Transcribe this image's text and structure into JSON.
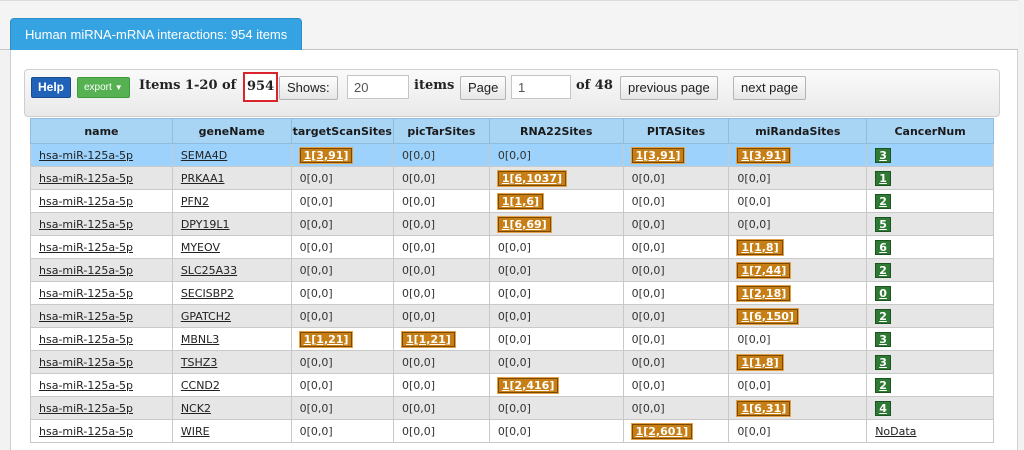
{
  "tab": {
    "title": "Human miRNA-mRNA interactions: 954 items"
  },
  "toolbar": {
    "help_label": "Help",
    "export_label": "export",
    "items_prefix": "Items 1-20 of",
    "total": "954",
    "shows_label": "Shows:",
    "shows_value": "20",
    "items_label": "items",
    "page_label": "Page",
    "page_value": "1",
    "of_pages": "of 48",
    "prev_label": "previous page",
    "next_label": "next page"
  },
  "table": {
    "columns": [
      "name",
      "geneName",
      "targetScanSites",
      "picTarSites",
      "RNA22Sites",
      "PITASites",
      "miRandaSites",
      "CancerNum"
    ],
    "rows": [
      {
        "name": "hsa-miR-125a-5p",
        "gene": "SEMA4D",
        "ts": "1[3,91]",
        "pt": "0[0,0]",
        "r22": "0[0,0]",
        "pita": "1[3,91]",
        "mir": "1[3,91]",
        "cancer": "3"
      },
      {
        "name": "hsa-miR-125a-5p",
        "gene": "PRKAA1",
        "ts": "0[0,0]",
        "pt": "0[0,0]",
        "r22": "1[6,1037]",
        "pita": "0[0,0]",
        "mir": "0[0,0]",
        "cancer": "1"
      },
      {
        "name": "hsa-miR-125a-5p",
        "gene": "PFN2",
        "ts": "0[0,0]",
        "pt": "0[0,0]",
        "r22": "1[1,6]",
        "pita": "0[0,0]",
        "mir": "0[0,0]",
        "cancer": "2"
      },
      {
        "name": "hsa-miR-125a-5p",
        "gene": "DPY19L1",
        "ts": "0[0,0]",
        "pt": "0[0,0]",
        "r22": "1[6,69]",
        "pita": "0[0,0]",
        "mir": "0[0,0]",
        "cancer": "5"
      },
      {
        "name": "hsa-miR-125a-5p",
        "gene": "MYEOV",
        "ts": "0[0,0]",
        "pt": "0[0,0]",
        "r22": "0[0,0]",
        "pita": "0[0,0]",
        "mir": "1[1,8]",
        "cancer": "6"
      },
      {
        "name": "hsa-miR-125a-5p",
        "gene": "SLC25A33",
        "ts": "0[0,0]",
        "pt": "0[0,0]",
        "r22": "0[0,0]",
        "pita": "0[0,0]",
        "mir": "1[7,44]",
        "cancer": "2"
      },
      {
        "name": "hsa-miR-125a-5p",
        "gene": "SECISBP2",
        "ts": "0[0,0]",
        "pt": "0[0,0]",
        "r22": "0[0,0]",
        "pita": "0[0,0]",
        "mir": "1[2,18]",
        "cancer": "0"
      },
      {
        "name": "hsa-miR-125a-5p",
        "gene": "GPATCH2",
        "ts": "0[0,0]",
        "pt": "0[0,0]",
        "r22": "0[0,0]",
        "pita": "0[0,0]",
        "mir": "1[6,150]",
        "cancer": "2"
      },
      {
        "name": "hsa-miR-125a-5p",
        "gene": "MBNL3",
        "ts": "1[1,21]",
        "pt": "1[1,21]",
        "r22": "0[0,0]",
        "pita": "0[0,0]",
        "mir": "0[0,0]",
        "cancer": "3"
      },
      {
        "name": "hsa-miR-125a-5p",
        "gene": "TSHZ3",
        "ts": "0[0,0]",
        "pt": "0[0,0]",
        "r22": "0[0,0]",
        "pita": "0[0,0]",
        "mir": "1[1,8]",
        "cancer": "3"
      },
      {
        "name": "hsa-miR-125a-5p",
        "gene": "CCND2",
        "ts": "0[0,0]",
        "pt": "0[0,0]",
        "r22": "1[2,416]",
        "pita": "0[0,0]",
        "mir": "0[0,0]",
        "cancer": "2"
      },
      {
        "name": "hsa-miR-125a-5p",
        "gene": "NCK2",
        "ts": "0[0,0]",
        "pt": "0[0,0]",
        "r22": "0[0,0]",
        "pita": "0[0,0]",
        "mir": "1[6,31]",
        "cancer": "4"
      },
      {
        "name": "hsa-miR-125a-5p",
        "gene": "WIRE",
        "ts": "0[0,0]",
        "pt": "0[0,0]",
        "r22": "0[0,0]",
        "pita": "1[2,601]",
        "mir": "0[0,0]",
        "cancer": "NoData"
      }
    ]
  },
  "colors": {
    "tab": "#35a3e2",
    "header": "#a9d5f5",
    "selected_row": "#9cd2fb",
    "site_badge": "#c77e14",
    "cancer_badge": "#2e7a35",
    "highlight_box": "#d9232d"
  }
}
